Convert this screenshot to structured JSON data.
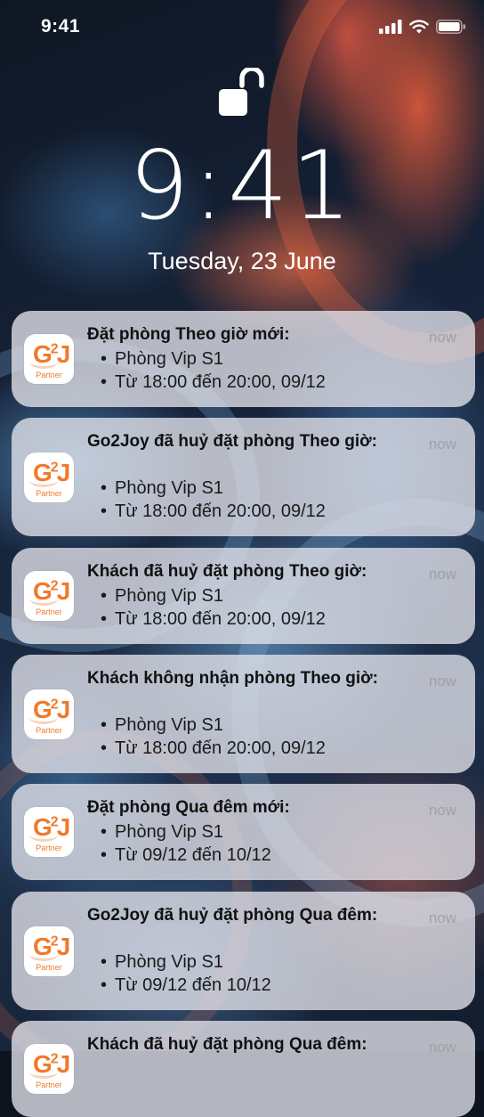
{
  "status_bar": {
    "time": "9:41"
  },
  "lock_screen": {
    "time": "9:41",
    "date": "Tuesday, 23 June"
  },
  "app": {
    "name": "Partner",
    "accent": "#f07a2a"
  },
  "notifications": [
    {
      "title": "Đặt phòng Theo giờ mới:",
      "time": "now",
      "lines": [
        "Phòng Vip S1",
        "Từ 18:00 đến 20:00, 09/12"
      ]
    },
    {
      "title": "Go2Joy đã huỷ đặt phòng Theo giờ:",
      "time": "now",
      "lines": [
        "Phòng Vip S1",
        "Từ 18:00 đến 20:00, 09/12"
      ]
    },
    {
      "title": "Khách đã huỷ đặt phòng Theo giờ:",
      "time": "now",
      "lines": [
        "Phòng Vip S1",
        "Từ 18:00 đến 20:00, 09/12"
      ]
    },
    {
      "title": "Khách không nhận phòng Theo giờ:",
      "time": "now",
      "lines": [
        "Phòng Vip S1",
        "Từ 18:00 đến 20:00, 09/12"
      ]
    },
    {
      "title": "Đặt phòng Qua đêm mới:",
      "time": "now",
      "lines": [
        "Phòng Vip S1",
        "Từ 09/12 đến 10/12"
      ]
    },
    {
      "title": "Go2Joy đã huỷ đặt phòng Qua đêm:",
      "time": "now",
      "lines": [
        "Phòng Vip S1",
        "Từ 09/12 đến 10/12"
      ]
    },
    {
      "title": "Khách đã huỷ đặt phòng Qua đêm:",
      "time": "now",
      "lines": []
    }
  ]
}
